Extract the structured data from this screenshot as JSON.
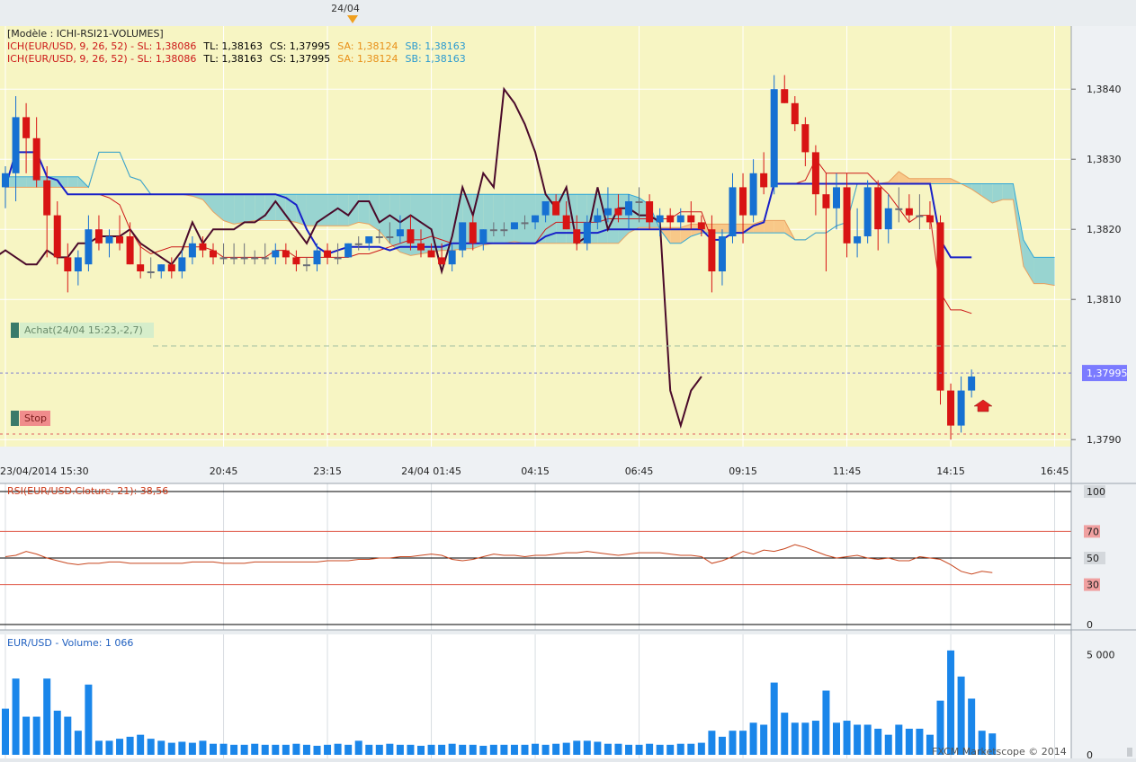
{
  "header": {
    "date_marker": "24/04"
  },
  "legend": {
    "model": "[Modèle : ICHI-RSI21-VOLUMES]",
    "lines": [
      {
        "prefix": "ICH(EUR/USD, 9, 26, 52) -  SL: 1,38086",
        "tl": "TL: 1,38163",
        "cs": "CS: 1,37995",
        "sa": "SA: 1,38124",
        "sb": "SB: 1,38163"
      },
      {
        "prefix": "ICH(EUR/USD, 9, 26, 52) -  SL: 1,38086",
        "tl": "TL: 1,38163",
        "cs": "CS: 1,37995",
        "sa": "SA: 1,38124",
        "sb": "SB: 1,38163"
      }
    ]
  },
  "orders": {
    "buy_label": "Achat(24/04 15:23,-2,7)",
    "stop_label": "Stop"
  },
  "colors": {
    "bull": "#1670d2",
    "bear": "#d81414",
    "neutral": "#6b6f78",
    "tenkan": "#cc1818",
    "kijun": "#1820c8",
    "chikou": "#4a0a2a",
    "senkou_b": "#30a8d8",
    "cloud_bull": "#f8c888",
    "cloud_bear": "#98d4d0",
    "volume": "#1a86ea",
    "price_area_bg": "#f7f5c3",
    "last_price_tag": "#7b7bff"
  },
  "chart_data": [
    {
      "type": "candlestick",
      "title": "EUR/USD",
      "y_ticks": [
        "1,3840",
        "1,3830",
        "1,3820",
        "1,3810",
        "1,3790"
      ],
      "ylim": [
        1.3789,
        1.3849
      ],
      "last_price": "1,37995",
      "x_tick_labels": [
        "23/04/2014 15:30",
        "20:45",
        "23:15",
        "24/04 01:45",
        "04:15",
        "06:45",
        "09:15",
        "11:45",
        "14:15",
        "16:45"
      ],
      "x_tick_index": [
        0,
        21,
        31,
        41,
        51,
        61,
        71,
        81,
        91,
        101
      ],
      "candles": [
        [
          1.3826,
          1.3829,
          1.3823,
          1.3828
        ],
        [
          1.3828,
          1.3839,
          1.3824,
          1.3836
        ],
        [
          1.3836,
          1.3838,
          1.3828,
          1.3833
        ],
        [
          1.3833,
          1.3836,
          1.3826,
          1.3827
        ],
        [
          1.3827,
          1.3829,
          1.3816,
          1.3822
        ],
        [
          1.3822,
          1.3824,
          1.3815,
          1.3816
        ],
        [
          1.3816,
          1.3818,
          1.3811,
          1.3814
        ],
        [
          1.3814,
          1.3817,
          1.3812,
          1.3816
        ],
        [
          1.3815,
          1.3822,
          1.3814,
          1.382
        ],
        [
          1.382,
          1.3822,
          1.3817,
          1.3818
        ],
        [
          1.3818,
          1.382,
          1.3816,
          1.3819
        ],
        [
          1.3819,
          1.3822,
          1.3817,
          1.3818
        ],
        [
          1.3819,
          1.3821,
          1.3815,
          1.3815
        ],
        [
          1.3815,
          1.3818,
          1.3813,
          1.3814
        ],
        [
          1.3814,
          1.3816,
          1.3813,
          1.3814
        ],
        [
          1.3814,
          1.3815,
          1.3813,
          1.3815
        ],
        [
          1.3815,
          1.3816,
          1.3813,
          1.3814
        ],
        [
          1.3814,
          1.3817,
          1.3813,
          1.3816
        ],
        [
          1.3816,
          1.3819,
          1.3815,
          1.3818
        ],
        [
          1.3818,
          1.3819,
          1.3816,
          1.3817
        ],
        [
          1.3817,
          1.3818,
          1.3815,
          1.3816
        ],
        [
          1.3816,
          1.3818,
          1.3815,
          1.3816
        ],
        [
          1.3816,
          1.3818,
          1.3815,
          1.3816
        ],
        [
          1.3816,
          1.3818,
          1.3815,
          1.3816
        ],
        [
          1.3816,
          1.3817,
          1.3815,
          1.3816
        ],
        [
          1.3816,
          1.3818,
          1.3815,
          1.3816
        ],
        [
          1.3816,
          1.3818,
          1.3815,
          1.3817
        ],
        [
          1.3817,
          1.3818,
          1.3815,
          1.3816
        ],
        [
          1.3816,
          1.3817,
          1.3814,
          1.3815
        ],
        [
          1.3815,
          1.3816,
          1.3814,
          1.3815
        ],
        [
          1.3815,
          1.3818,
          1.3814,
          1.3817
        ],
        [
          1.3817,
          1.3818,
          1.3815,
          1.3816
        ],
        [
          1.3816,
          1.3818,
          1.3815,
          1.3816
        ],
        [
          1.3816,
          1.3818,
          1.3816,
          1.3818
        ],
        [
          1.3818,
          1.3819,
          1.3817,
          1.3818
        ],
        [
          1.3818,
          1.3819,
          1.3817,
          1.3819
        ],
        [
          1.3819,
          1.382,
          1.3818,
          1.3819
        ],
        [
          1.3819,
          1.3821,
          1.3818,
          1.3819
        ],
        [
          1.3819,
          1.3822,
          1.3818,
          1.382
        ],
        [
          1.382,
          1.3822,
          1.3817,
          1.3818
        ],
        [
          1.3818,
          1.382,
          1.3816,
          1.3817
        ],
        [
          1.3817,
          1.3818,
          1.3816,
          1.3816
        ],
        [
          1.3816,
          1.3818,
          1.3815,
          1.3815
        ],
        [
          1.3815,
          1.3818,
          1.3814,
          1.3817
        ],
        [
          1.3817,
          1.3821,
          1.3816,
          1.3821
        ],
        [
          1.3821,
          1.3822,
          1.3817,
          1.3818
        ],
        [
          1.3818,
          1.382,
          1.3817,
          1.382
        ],
        [
          1.382,
          1.3821,
          1.3819,
          1.382
        ],
        [
          1.382,
          1.3821,
          1.3819,
          1.382
        ],
        [
          1.382,
          1.3821,
          1.382,
          1.3821
        ],
        [
          1.3821,
          1.3822,
          1.382,
          1.3821
        ],
        [
          1.3821,
          1.3822,
          1.382,
          1.3822
        ],
        [
          1.3822,
          1.3824,
          1.3821,
          1.3824
        ],
        [
          1.3824,
          1.3825,
          1.3822,
          1.3822
        ],
        [
          1.3822,
          1.3824,
          1.382,
          1.382
        ],
        [
          1.382,
          1.3822,
          1.3817,
          1.3818
        ],
        [
          1.3818,
          1.3822,
          1.3817,
          1.3821
        ],
        [
          1.3821,
          1.3823,
          1.382,
          1.3822
        ],
        [
          1.3822,
          1.3826,
          1.3821,
          1.3823
        ],
        [
          1.3823,
          1.3825,
          1.3821,
          1.3822
        ],
        [
          1.3822,
          1.3825,
          1.382,
          1.3824
        ],
        [
          1.3824,
          1.3826,
          1.3821,
          1.3824
        ],
        [
          1.3824,
          1.3825,
          1.382,
          1.3821
        ],
        [
          1.3821,
          1.3823,
          1.3819,
          1.3822
        ],
        [
          1.3822,
          1.3823,
          1.382,
          1.3821
        ],
        [
          1.3821,
          1.3823,
          1.382,
          1.3822
        ],
        [
          1.3822,
          1.3824,
          1.382,
          1.3821
        ],
        [
          1.3821,
          1.3822,
          1.3819,
          1.382
        ],
        [
          1.382,
          1.3822,
          1.3811,
          1.3814
        ],
        [
          1.3814,
          1.382,
          1.3812,
          1.3819
        ],
        [
          1.3819,
          1.3828,
          1.3818,
          1.3826
        ],
        [
          1.3826,
          1.3828,
          1.3818,
          1.3822
        ],
        [
          1.3822,
          1.383,
          1.3821,
          1.3828
        ],
        [
          1.3828,
          1.3831,
          1.3825,
          1.3826
        ],
        [
          1.3826,
          1.3842,
          1.3825,
          1.384
        ],
        [
          1.384,
          1.3842,
          1.3838,
          1.3838
        ],
        [
          1.3838,
          1.3839,
          1.3834,
          1.3835
        ],
        [
          1.3835,
          1.3836,
          1.3829,
          1.3831
        ],
        [
          1.3831,
          1.3832,
          1.3822,
          1.3825
        ],
        [
          1.3825,
          1.3828,
          1.3814,
          1.3823
        ],
        [
          1.3823,
          1.3828,
          1.382,
          1.3826
        ],
        [
          1.3826,
          1.3828,
          1.3816,
          1.3818
        ],
        [
          1.3818,
          1.3823,
          1.3816,
          1.3819
        ],
        [
          1.3819,
          1.3827,
          1.3818,
          1.3826
        ],
        [
          1.3826,
          1.3827,
          1.3817,
          1.382
        ],
        [
          1.382,
          1.3825,
          1.3818,
          1.3823
        ],
        [
          1.3823,
          1.3826,
          1.3821,
          1.3823
        ],
        [
          1.3823,
          1.3825,
          1.3821,
          1.3822
        ],
        [
          1.3822,
          1.3825,
          1.382,
          1.3822
        ],
        [
          1.3822,
          1.3824,
          1.382,
          1.3821
        ],
        [
          1.3821,
          1.3822,
          1.3795,
          1.3797
        ],
        [
          1.3797,
          1.3798,
          1.379,
          1.3792
        ],
        [
          1.3792,
          1.3799,
          1.3791,
          1.3797
        ],
        [
          1.3797,
          1.38,
          1.3796,
          1.3799
        ]
      ]
    },
    {
      "type": "line",
      "title": "RSI(EUR/USD.Cloture, 21): 38,56",
      "ylim": [
        0,
        100
      ],
      "y_ticks": [
        "100",
        "70",
        "50",
        "30",
        "0"
      ],
      "levels": [
        100,
        70,
        50,
        30,
        0
      ],
      "values": [
        51,
        52,
        55,
        53,
        50,
        48,
        46,
        45,
        46,
        46,
        47,
        47,
        46,
        46,
        46,
        46,
        46,
        46,
        47,
        47,
        47,
        46,
        46,
        46,
        47,
        47,
        47,
        47,
        47,
        47,
        47,
        48,
        48,
        48,
        49,
        49,
        50,
        50,
        51,
        51,
        52,
        53,
        52,
        49,
        48,
        49,
        51,
        53,
        52,
        52,
        51,
        52,
        52,
        53,
        54,
        54,
        55,
        54,
        53,
        52,
        53,
        54,
        54,
        54,
        53,
        52,
        52,
        51,
        46,
        48,
        51,
        55,
        53,
        56,
        55,
        57,
        60,
        58,
        55,
        52,
        50,
        51,
        52,
        50,
        49,
        50,
        48,
        48,
        51,
        50,
        49,
        45,
        40,
        38,
        40,
        39
      ]
    },
    {
      "type": "bar",
      "title": "EUR/USD - Volume: 1 066",
      "ylim": [
        0,
        6000
      ],
      "y_ticks": [
        "5 000",
        "0"
      ],
      "values": [
        2300,
        3800,
        1900,
        1900,
        3800,
        2200,
        1900,
        1200,
        3500,
        700,
        700,
        800,
        900,
        1000,
        800,
        700,
        600,
        650,
        600,
        700,
        550,
        550,
        500,
        500,
        550,
        500,
        500,
        500,
        550,
        500,
        450,
        500,
        550,
        500,
        700,
        500,
        500,
        550,
        500,
        500,
        450,
        500,
        500,
        550,
        500,
        500,
        450,
        500,
        500,
        500,
        500,
        550,
        500,
        550,
        600,
        700,
        700,
        650,
        550,
        550,
        500,
        500,
        550,
        500,
        500,
        550,
        550,
        600,
        1200,
        900,
        1200,
        1200,
        1600,
        1500,
        3600,
        2100,
        1600,
        1600,
        1700,
        3200,
        1600,
        1700,
        1500,
        1500,
        1300,
        1000,
        1500,
        1300,
        1300,
        1000,
        2700,
        5200,
        3900,
        2800,
        1200,
        1066
      ],
      "watermark": "FXCM Marketscope © 2014"
    }
  ]
}
